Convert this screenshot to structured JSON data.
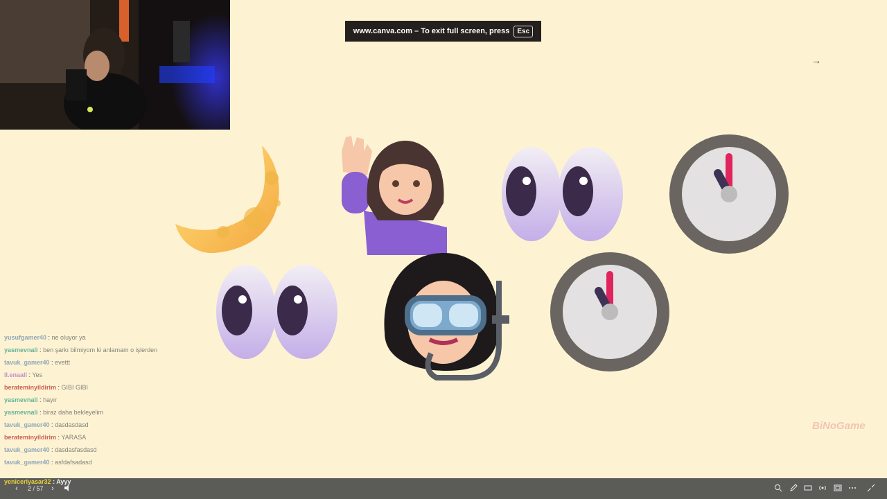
{
  "fullscreen_banner": {
    "message": "www.canva.com – To exit full screen, press",
    "key": "Esc"
  },
  "next_arrow": "→",
  "chat": {
    "messages": [
      {
        "user": "yusufgamer40",
        "text": "ne oluyor ya",
        "color": "#6c8fb0"
      },
      {
        "user": "yasmevnali",
        "text": "ben şarkı bilmiyom ki anlamam o işlerden",
        "color": "#2e9d82"
      },
      {
        "user": "tavuk_gamer40",
        "text": "evettt",
        "color": "#6c8fb0"
      },
      {
        "user": "ll.enaall",
        "text": "Yes",
        "color": "#b36cc8"
      },
      {
        "user": "berateminyildirim",
        "text": "GIBI GIBI",
        "color": "#b82b2b"
      },
      {
        "user": "yasmevnali",
        "text": "hayır",
        "color": "#2e9d82"
      },
      {
        "user": "yasmevnali",
        "text": "biraz daha bekleyelim",
        "color": "#2e9d82"
      },
      {
        "user": "tavuk_gamer40",
        "text": "dasdasdasd",
        "color": "#6c8fb0"
      },
      {
        "user": "berateminyildirim",
        "text": "YARASA",
        "color": "#b82b2b"
      },
      {
        "user": "tavuk_gamer40",
        "text": "dasdasfasdasd",
        "color": "#6c8fb0"
      },
      {
        "user": "tavuk_gamer40",
        "text": "asfdafsadasd",
        "color": "#6c8fb0"
      }
    ],
    "latest": {
      "user": "yeniceriyasar32",
      "text": "Ayyy",
      "color": "#e8d23a"
    }
  },
  "watermark": "BiNoGame",
  "bottom_bar": {
    "page_indicator": "2 / 57",
    "prev_label": "‹",
    "next_label": "›"
  },
  "emojis": [
    "crescent-moon",
    "woman-waving",
    "eyes",
    "one-oclock",
    "eyes",
    "woman-snorkel",
    "one-oclock"
  ]
}
